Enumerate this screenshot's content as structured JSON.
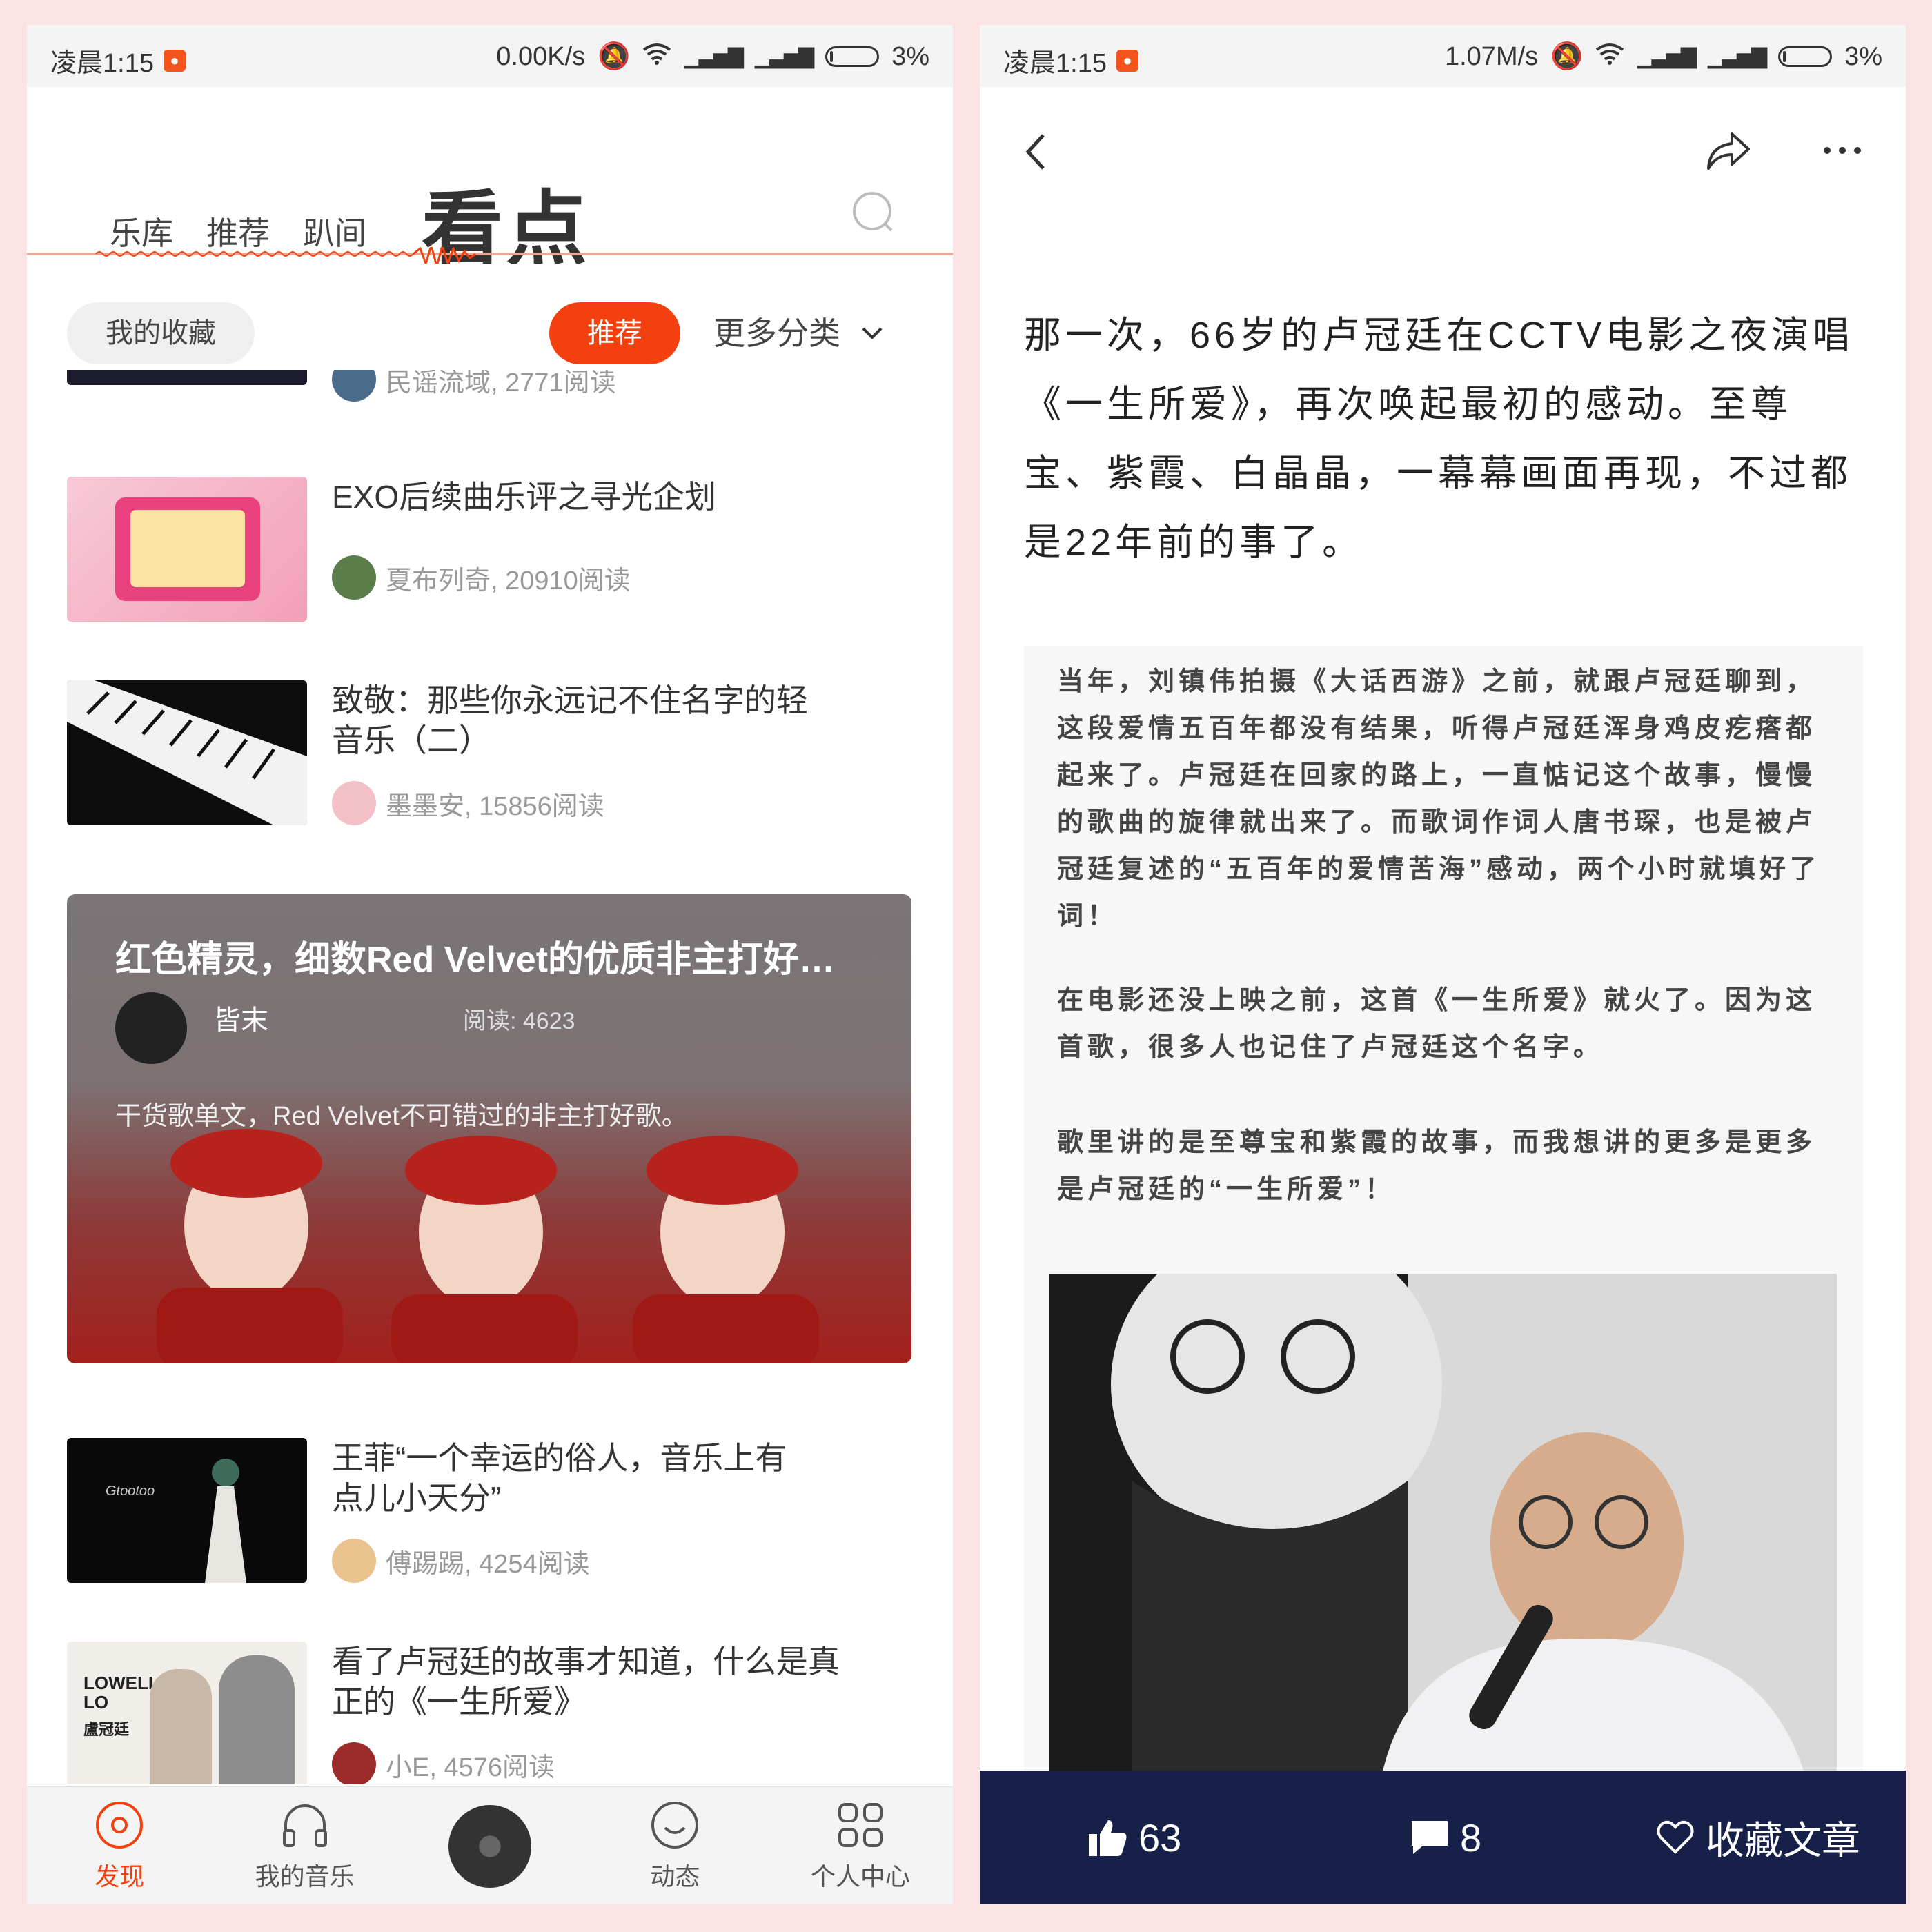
{
  "status_left": {
    "time": "凌晨1:15",
    "speed": "0.00K/s",
    "battery": "3%"
  },
  "status_right": {
    "time": "凌晨1:15",
    "speed": "1.07M/s",
    "battery": "3%"
  },
  "header": {
    "tabs": [
      "乐库",
      "推荐",
      "趴间"
    ],
    "active_tab": "看点"
  },
  "filters": {
    "favorites": "我的收藏",
    "recommend": "推荐",
    "more": "更多分类"
  },
  "feed": {
    "partial_meta": "民谣流域, 2771阅读",
    "items": [
      {
        "title": "EXO后续曲乐评之寻光企划",
        "author": "夏布列奇",
        "reads": "20910阅读"
      },
      {
        "title": "致敬：那些你永远记不住名字的轻音乐（二）",
        "author": "墨墨安",
        "reads": "15856阅读"
      },
      {
        "title": "王菲“一个幸运的俗人，音乐上有点儿小天分”",
        "author": "傅踢踢",
        "reads": "4254阅读"
      },
      {
        "title": "看了卢冠廷的故事才知道，什么是真正的《一生所爱》",
        "author": "小E",
        "reads": "4576阅读"
      }
    ],
    "featured": {
      "title": "红色精灵，细数Red Velvet的优质非主打好…",
      "author": "皆末",
      "reads": "阅读: 4623",
      "desc": "干货歌单文，Red Velvet不可错过的非主打好歌。"
    },
    "thumb_texts": {
      "lowell": "LOWELL LO",
      "lowell_cn": "盧冠廷",
      "gt": "Gtootoo"
    }
  },
  "nav": {
    "items": [
      {
        "label": "发现",
        "icon": "discover-icon"
      },
      {
        "label": "我的音乐",
        "icon": "headphones-icon"
      },
      {
        "label": "",
        "icon": "disc-icon"
      },
      {
        "label": "动态",
        "icon": "smile-icon"
      },
      {
        "label": "个人中心",
        "icon": "grid-icon"
      }
    ]
  },
  "article": {
    "intro": "那一次，66岁的卢冠廷在CCTV电影之夜演唱《一生所爱》，再次唤起最初的感动。至尊宝、紫霞、白晶晶，一幕幕画面再现，不过都是22年前的事了。",
    "quote_p1": "当年，刘镇伟拍摄《大话西游》之前，就跟卢冠廷聊到，这段爱情五百年都没有结果，听得卢冠廷浑身鸡皮疙瘩都起来了。卢冠廷在回家的路上，一直惦记这个故事，慢慢的歌曲的旋律就出来了。而歌词作词人唐书琛，也是被卢冠廷复述的“五百年的爱情苦海”感动，两个小时就填好了词！",
    "quote_p2": "在电影还没上映之前，这首《一生所爱》就火了。因为这首歌，很多人也记住了卢冠廷这个名字。",
    "quote_p3": "歌里讲的是至尊宝和紫霞的故事，而我想讲的更多是更多是卢冠廷的“一生所爱”！"
  },
  "actions": {
    "likes": "63",
    "comments": "8",
    "collect": "收藏文章"
  },
  "colors": {
    "accent": "#f2400f",
    "bar": "#162049"
  }
}
